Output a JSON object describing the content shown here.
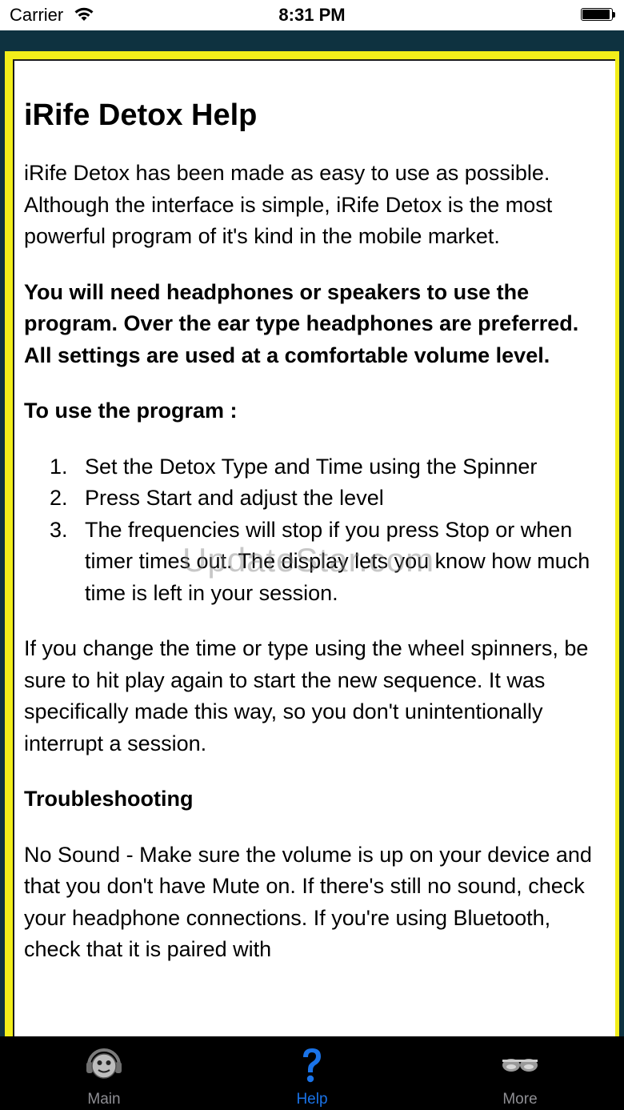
{
  "status_bar": {
    "carrier": "Carrier",
    "time": "8:31 PM"
  },
  "colors": {
    "frame_background": "#0e3240",
    "border_yellow": "#f2ee1a",
    "tab_active": "#1a73e8",
    "tab_inactive": "#8e8e93"
  },
  "content": {
    "title": "iRife Detox Help",
    "intro": "iRife Detox has been made as easy to use as possible. Although the interface is simple, iRife Detox is the most powerful program of it's kind in the mobile market.",
    "requirement": "You will need headphones or speakers to use the program. Over the ear type headphones are preferred. All settings are used at a comfortable volume level.",
    "usage_heading": "To use the program :",
    "steps": [
      {
        "num": "1.",
        "text": "Set the Detox Type and Time using the Spinner"
      },
      {
        "num": "2.",
        "text": "Press Start and adjust the level"
      },
      {
        "num": "3.",
        "text": "The frequencies will stop if you press Stop or when timer times out. The display lets you know how much time is left in your session."
      }
    ],
    "change_note": "If you change the time or type using the wheel spinners, be sure to hit play again to start the new sequence. It was specifically made this way, so you don't unintentionally interrupt a session.",
    "troubleshooting_heading": "Troubleshooting",
    "no_sound": "No Sound - Make sure the volume is up on your device and that you don't have Mute on. If there's still no sound, check your headphone connections. If you're using Bluetooth, check that it is paired with"
  },
  "watermark": "UpdateStar.com",
  "tab_bar": {
    "tabs": [
      {
        "label": "Main",
        "icon": "face-headphones-icon",
        "active": false
      },
      {
        "label": "Help",
        "icon": "question-mark-icon",
        "active": true
      },
      {
        "label": "More",
        "icon": "more-icon",
        "active": false
      }
    ]
  }
}
